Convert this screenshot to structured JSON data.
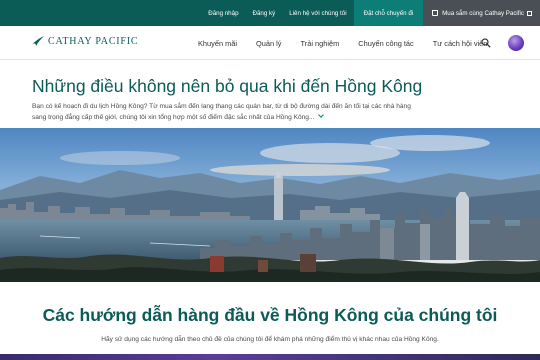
{
  "topbar": {
    "login": "Đăng nhập",
    "register": "Đăng ký",
    "contact": "Liên hệ với chúng tôi",
    "book": "Đặt chỗ chuyến đi",
    "shop": "Mua sắm cùng Cathay Pacific"
  },
  "brand": {
    "name": "CATHAY PACIFIC"
  },
  "nav": {
    "items": [
      "Khuyến mãi",
      "Quản lý",
      "Trải nghiệm",
      "Chuyến công tác",
      "Tư cách hội viên"
    ]
  },
  "hero": {
    "title": "Những điều không nên bỏ qua khi đến Hồng Kông",
    "description": "Bạn có kế hoạch đi du lịch Hồng Kông? Từ mua sắm đến lang thang các quán bar, từ di bộ đường dài đến ăn tối tại các nhà hàng sang trọng đẳng cấp thế giới, chúng tôi xin tổng hợp một số điểm đặc sắc nhất của Hồng Kông..."
  },
  "guides": {
    "title": "Các hướng dẫn hàng đầu về Hồng Kông của chúng tôi",
    "subtitle": "Hãy sử dụng các hướng dẫn theo chủ đề của chúng tôi để khám phá những điểm thú vị khác nhau của Hồng Kông."
  },
  "colors": {
    "brand_teal": "#0b5b57",
    "accent_teal": "#0c7d77",
    "shop_gray": "#4a4f55"
  },
  "icons": [
    "logo-brushwing-icon",
    "search-icon",
    "avatar",
    "shopping-bag-icon",
    "external-link-icon",
    "chevron-down-icon"
  ]
}
